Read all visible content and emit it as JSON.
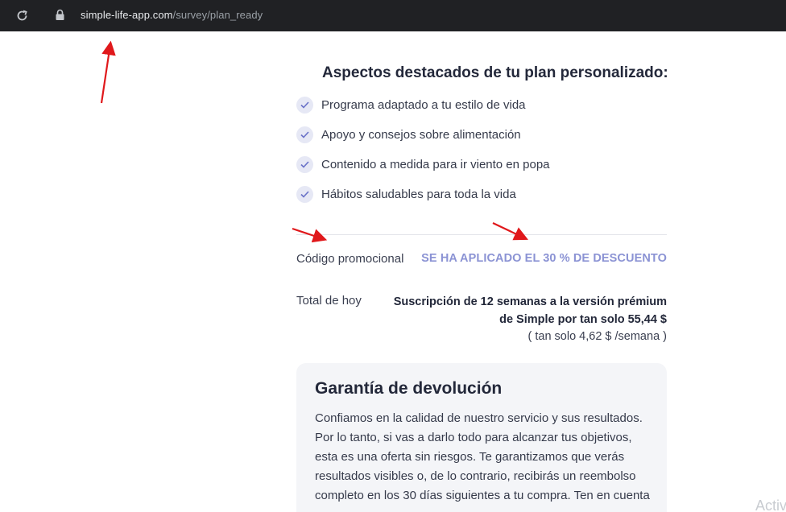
{
  "browser": {
    "url_host": "simple-life-app.com",
    "url_path": "/survey/plan_ready"
  },
  "plan": {
    "title": "Aspectos destacados de tu plan personalizado:",
    "features": [
      "Programa adaptado a tu estilo de vida",
      "Apoyo y consejos sobre alimentación",
      "Contenido a medida para ir viento en popa",
      "Hábitos saludables para toda la vida"
    ]
  },
  "promo": {
    "label": "Código promocional",
    "value": "SE HA APLICADO EL 30 % DE DESCUENTO"
  },
  "total": {
    "label": "Total de hoy",
    "description": "Suscripción de 12 semanas a la versión prémium de Simple por tan solo 55,44 $",
    "weekly": "( tan solo 4,62 $ /semana )"
  },
  "guarantee": {
    "title": "Garantía de devolución",
    "text": "Confiamos en la calidad de nuestro servicio y sus resultados. Por lo tanto, si vas a darlo todo para alcanzar tus objetivos, esta es una oferta sin riesgos. Te garantizamos que verás resultados visibles o, de lo contrario, recibirás un reembolso completo en los 30 días siguientes a tu compra. Ten en cuenta que…"
  },
  "watermark": "Activ",
  "colors": {
    "browser_bar": "#202124",
    "accent": "#8b93d4",
    "annotation_arrow": "#e0181b"
  }
}
